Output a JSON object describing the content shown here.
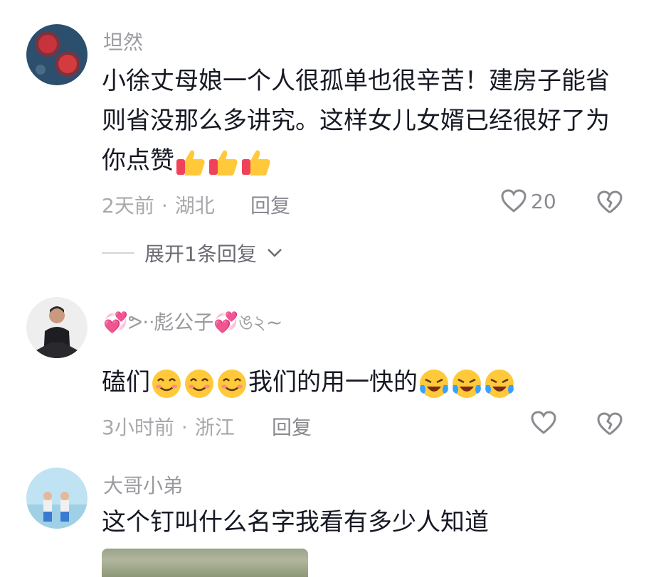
{
  "comments": [
    {
      "username": "坦然",
      "text_lines": [
        "小徐丈母娘一个人很孤单也很辛苦！建房子能省",
        "则省没那么多讲究。这样女儿女婿已经很好了为",
        "你点赞"
      ],
      "time": "2天前",
      "location": "湖北",
      "reply_label": "回复",
      "like_count": "20",
      "expand_label": "展开1条回复"
    },
    {
      "username": "彪公子",
      "text_before": "磕们",
      "text_after": "我们的用一快的",
      "time": "3小时前",
      "location": "浙江",
      "reply_label": "回复",
      "like_count": ""
    },
    {
      "username": "大哥小弟",
      "text": "这个钉叫什么名字我看有多少人知道"
    }
  ],
  "colors": {
    "text": "#161823",
    "meta": "#a9a9ad",
    "username": "#9a9a9f"
  },
  "icons": [
    "thumbs-up-emoji",
    "heart-outline-icon",
    "broken-heart-icon",
    "chevron-down-icon",
    "smiling-emoji",
    "crying-laughing-emoji"
  ]
}
